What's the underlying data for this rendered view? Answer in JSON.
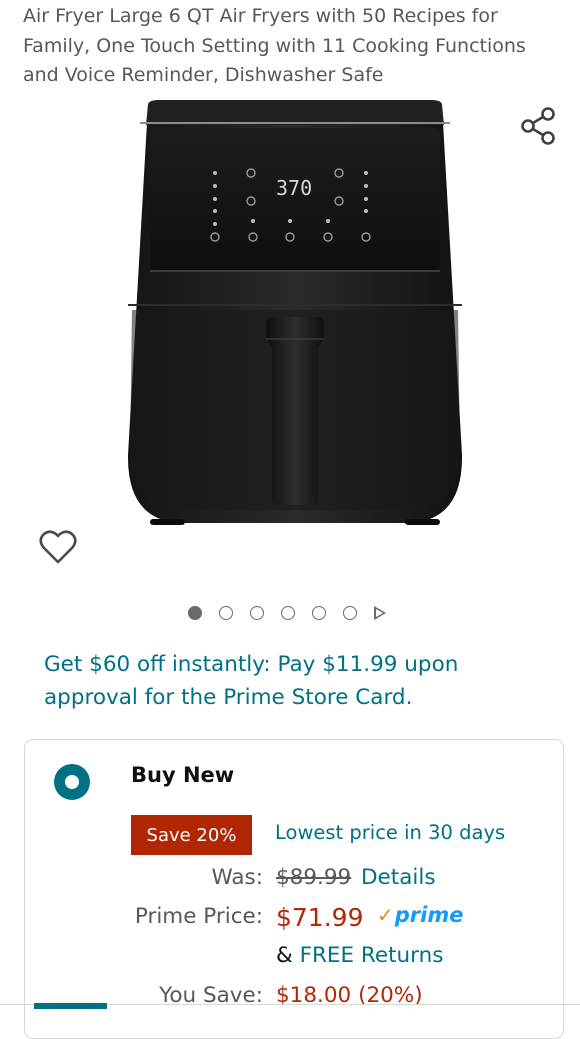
{
  "product": {
    "title": "Air Fryer Large 6 QT Air Fryers with 50 Recipes for Family, One Touch Setting with 11 Cooking Functions and Voice Reminder, Dishwasher Safe",
    "display_temperature": "370"
  },
  "icons": {
    "share": "share-icon",
    "wishlist": "heart-outline-icon",
    "next": "play-arrow-icon"
  },
  "carousel": {
    "dot_count": 6,
    "active_index": 0
  },
  "promo": {
    "text": "Get $60 off instantly: Pay $11.99 upon approval for the Prime Store Card."
  },
  "buybox": {
    "option_label": "Buy New",
    "save_badge": "Save 20%",
    "lowest_price": "Lowest price in 30 days",
    "was_label": "Was:",
    "was_price": "$89.99",
    "details_link": "Details",
    "prime_price_label": "Prime Price:",
    "price": "$71.99",
    "prime_check": "✓",
    "prime_word": "prime",
    "returns_prefix": "& ",
    "returns_link": "FREE Returns",
    "you_save_label": "You Save:",
    "you_save_value": "$18.00 (20%)"
  },
  "colors": {
    "link": "#007185",
    "price": "#b12704",
    "save_badge": "#b12704",
    "prime_blue": "#1399ff",
    "prime_check": "#f08804"
  }
}
